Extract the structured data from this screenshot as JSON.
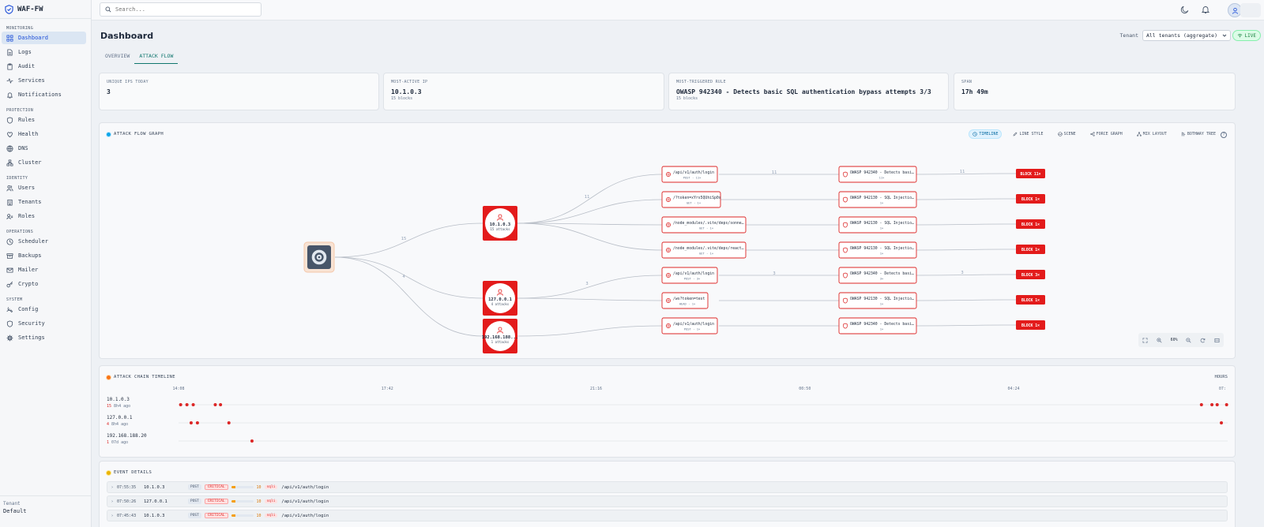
{
  "app": {
    "name": "WAF-FW"
  },
  "search": {
    "placeholder": "Search..."
  },
  "sidebar": {
    "sections": [
      {
        "title": "MONITORING",
        "items": [
          {
            "label": "Dashboard",
            "icon": "dashboard-icon",
            "active": true
          },
          {
            "label": "Logs",
            "icon": "file-icon"
          },
          {
            "label": "Audit",
            "icon": "clipboard-icon"
          },
          {
            "label": "Services",
            "icon": "activity-icon"
          },
          {
            "label": "Notifications",
            "icon": "bell-icon"
          }
        ]
      },
      {
        "title": "PROTECTION",
        "items": [
          {
            "label": "Rules",
            "icon": "shield-icon"
          },
          {
            "label": "Health",
            "icon": "heart-icon"
          },
          {
            "label": "DNS",
            "icon": "globe-icon"
          },
          {
            "label": "Cluster",
            "icon": "cluster-icon"
          }
        ]
      },
      {
        "title": "IDENTITY",
        "items": [
          {
            "label": "Users",
            "icon": "users-icon"
          },
          {
            "label": "Tenants",
            "icon": "building-icon"
          },
          {
            "label": "Roles",
            "icon": "roles-icon"
          }
        ]
      },
      {
        "title": "OPERATIONS",
        "items": [
          {
            "label": "Scheduler",
            "icon": "clock-icon"
          },
          {
            "label": "Backups",
            "icon": "archive-icon"
          },
          {
            "label": "Mailer",
            "icon": "mail-icon"
          },
          {
            "label": "Crypto",
            "icon": "key-icon"
          }
        ]
      },
      {
        "title": "SYSTEM",
        "items": [
          {
            "label": "Config",
            "icon": "config-icon"
          },
          {
            "label": "Security",
            "icon": "shield-icon"
          },
          {
            "label": "Settings",
            "icon": "gear-icon"
          }
        ]
      }
    ],
    "tenant_label": "Tenant",
    "tenant_value": "Default"
  },
  "header": {
    "title": "Dashboard",
    "tenant_label": "Tenant",
    "tenant_value": "All tenants (aggregate)",
    "live": "LIVE"
  },
  "tabs": [
    {
      "label": "OVERVIEW",
      "active": false
    },
    {
      "label": "ATTACK FLOW",
      "active": true
    }
  ],
  "stats": [
    {
      "label": "UNIQUE IPS TODAY",
      "value": "3",
      "sub": ""
    },
    {
      "label": "MOST-ACTIVE IP",
      "value": "10.1.0.3",
      "sub": "15 blocks"
    },
    {
      "label": "MOST-TRIGGERED RULE",
      "value": "OWASP 942340 - Detects basic SQL authentication bypass attempts 3/3",
      "sub": "15 blocks"
    },
    {
      "label": "SPAN",
      "value": "17h 49m",
      "sub": ""
    }
  ],
  "graph": {
    "title": "ATTACK FLOW GRAPH",
    "modes": [
      {
        "label": "TIMELINE",
        "icon": "clock-icon",
        "active": true
      },
      {
        "label": "LINE STYLE",
        "icon": "pen-icon"
      },
      {
        "label": "SCENE",
        "icon": "scene-icon"
      },
      {
        "label": "FORCE GRAPH",
        "icon": "share-icon"
      },
      {
        "label": "MIX LAYOUT",
        "icon": "layout-icon"
      },
      {
        "label": "BOTHWAY TREE",
        "icon": "tree-icon"
      }
    ],
    "help": "?",
    "zoom": "60%",
    "attackers": [
      {
        "ip": "10.1.0.3",
        "attacks": "15 attacks",
        "edge": "15"
      },
      {
        "ip": "127.0.0.1",
        "attacks": "4 attacks",
        "edge": "4"
      },
      {
        "ip": "192.168.188...",
        "attacks": "1 attacks",
        "edge": ""
      }
    ],
    "paths": [
      {
        "path": "/api/v1/auth/login",
        "meta": "POST · 11×",
        "in": "11",
        "mid": "11",
        "out": "11"
      },
      {
        "path": "/?token=xYrs5QUhiSp0s",
        "meta": "GET · 1×",
        "in": "",
        "mid": "",
        "out": ""
      },
      {
        "path": "/node_modules/.vite/deps/sonne…",
        "meta": "GET · 1×",
        "in": "",
        "mid": "",
        "out": ""
      },
      {
        "path": "/node_modules/.vite/deps/react…",
        "meta": "GET · 1×",
        "in": "",
        "mid": "",
        "out": ""
      },
      {
        "path": "/api/v1/auth/login",
        "meta": "POST · 3×",
        "in": "3",
        "mid": "3",
        "out": "3"
      },
      {
        "path": "/ws?token=test",
        "meta": "HEAD · 1×",
        "in": "",
        "mid": "",
        "out": ""
      },
      {
        "path": "/api/v1/auth/login",
        "meta": "POST · 1×",
        "in": "",
        "mid": "",
        "out": ""
      }
    ],
    "rules": [
      {
        "name": "OWASP 942340 - Detects basi…",
        "meta": "11×"
      },
      {
        "name": "OWASP 942130 - SQL Injectio…",
        "meta": "1×"
      },
      {
        "name": "OWASP 942130 - SQL Injectio…",
        "meta": "1×"
      },
      {
        "name": "OWASP 942130 - SQL Injectio…",
        "meta": "1×"
      },
      {
        "name": "OWASP 942340 - Detects basi…",
        "meta": "3×"
      },
      {
        "name": "OWASP 942130 - SQL Injectio…",
        "meta": "1×"
      },
      {
        "name": "OWASP 942340 - Detects basi…",
        "meta": "1×"
      }
    ],
    "actions": [
      "BLOCK 11×",
      "BLOCK 1×",
      "BLOCK 1×",
      "BLOCK 1×",
      "BLOCK 3×",
      "BLOCK 1×",
      "BLOCK 1×"
    ],
    "colors": {
      "attacker": "#e31b1b",
      "edge": "#b8bec7",
      "accent": "#dc2626"
    }
  },
  "timeline": {
    "title": "ATTACK CHAIN TIMELINE",
    "unit": "HOURS",
    "ticks": [
      "14:08",
      "17:42",
      "21:16",
      "00:50",
      "04:24",
      "07:"
    ],
    "rows": [
      {
        "ip": "10.1.0.3",
        "count": "15",
        "ago": "8h4 ago",
        "events": [
          0.002,
          0.008,
          0.014,
          0.035,
          0.04,
          0.975,
          0.985,
          0.99,
          0.999
        ]
      },
      {
        "ip": "127.0.0.1",
        "count": "4",
        "ago": "8h4 ago",
        "events": [
          0.012,
          0.018,
          0.048,
          0.994
        ]
      },
      {
        "ip": "192.168.188.20",
        "count": "1",
        "ago": "07d ago",
        "events": [
          0.07
        ]
      }
    ]
  },
  "events": {
    "title": "EVENT DETAILS",
    "rows": [
      {
        "time": "07:55:35",
        "ip": "10.1.0.3",
        "method": "POST",
        "severity": "CRITICAL",
        "score": 10,
        "score_fraction": 0.2,
        "category": "sqli",
        "path": "/api/v1/auth/login"
      },
      {
        "time": "07:50:26",
        "ip": "127.0.0.1",
        "method": "POST",
        "severity": "CRITICAL",
        "score": 10,
        "score_fraction": 0.2,
        "category": "sqli",
        "path": "/api/v1/auth/login"
      },
      {
        "time": "07:45:43",
        "ip": "10.1.0.3",
        "method": "POST",
        "severity": "CRITICAL",
        "score": 10,
        "score_fraction": 0.2,
        "category": "sqli",
        "path": "/api/v1/auth/login"
      }
    ]
  }
}
